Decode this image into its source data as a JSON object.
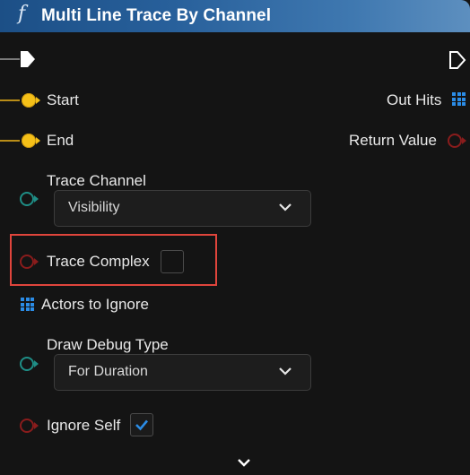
{
  "node": {
    "title": "Multi Line Trace By Channel",
    "function_icon": "f"
  },
  "pins": {
    "inputs": {
      "start": "Start",
      "end": "End",
      "trace_channel": "Trace Channel",
      "trace_complex": "Trace Complex",
      "actors_to_ignore": "Actors to Ignore",
      "draw_debug_type": "Draw Debug Type",
      "ignore_self": "Ignore Self"
    },
    "outputs": {
      "out_hits": "Out Hits",
      "return_value": "Return Value"
    }
  },
  "dropdowns": {
    "trace_channel_value": "Visibility",
    "draw_debug_type_value": "For Duration"
  },
  "checkboxes": {
    "trace_complex_checked": false,
    "ignore_self_checked": true
  },
  "colors": {
    "header_start": "#1c4f86",
    "header_end": "#5d8fbf",
    "vector_pin": "#f5c018",
    "enum_pin": "#1f8e86",
    "bool_pin": "#8a1c1c",
    "array_pin": "#2b8ce6",
    "highlight": "#e0453c"
  }
}
